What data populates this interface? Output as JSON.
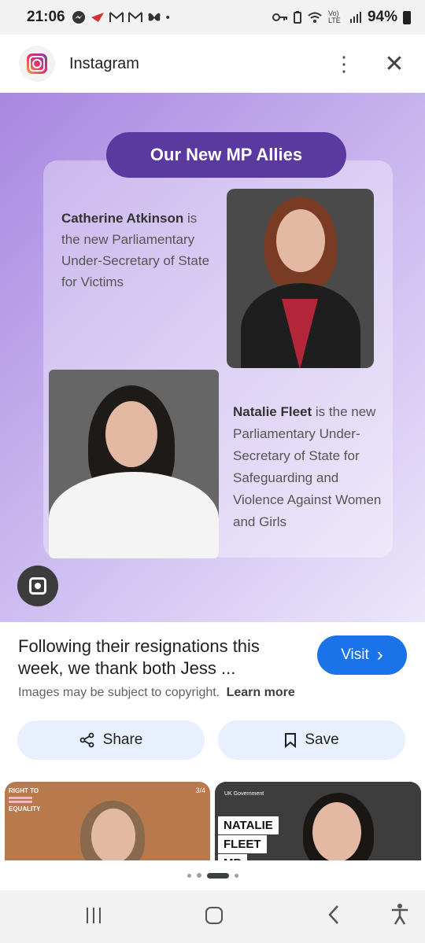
{
  "status": {
    "time": "21:06",
    "battery": "94%",
    "notif_icons": [
      "messenger-icon",
      "airline-icon",
      "gmail-icon",
      "gmail-icon",
      "butterfly-icon",
      "dot-icon"
    ],
    "system_icons": [
      "key-icon",
      "battery-saver-icon",
      "wifi-icon",
      "volte-icon",
      "signal-icon",
      "battery-icon"
    ],
    "volte_label": "Vo) LTE"
  },
  "appbar": {
    "title": "Instagram",
    "more_glyph": "⋮",
    "close_glyph": "✕"
  },
  "image": {
    "pill": "Our New MP Allies",
    "person1_name": "Catherine Atkinson",
    "person1_desc": "is the new Parliamentary Under-Secretary of State for Victims",
    "person2_name": "Natalie Fleet",
    "person2_desc": "is the new Parliamentary Under-Secretary of State for Safeguarding and Violence Against Women and Girls"
  },
  "info": {
    "title": "Following their resignations this week, we thank both Jess ...",
    "visit_label": "Visit",
    "visit_chevron": "›",
    "copyright": "Images may be subject to copyright.",
    "learn_more": "Learn more",
    "share_label": "Share",
    "save_label": "Save"
  },
  "thumbs": {
    "t1_tag_line1": "RIGHT TO",
    "t1_tag_line2": "EQUALITY",
    "t1_counter": "3/4",
    "t2_gov": "UK Government",
    "t2_name1": "NATALIE",
    "t2_name2": "FLEET",
    "t2_name3": "MP"
  },
  "colors": {
    "accent": "#1a73e8",
    "pill": "#5b3aa0",
    "action_bg": "#e8f0fe"
  }
}
